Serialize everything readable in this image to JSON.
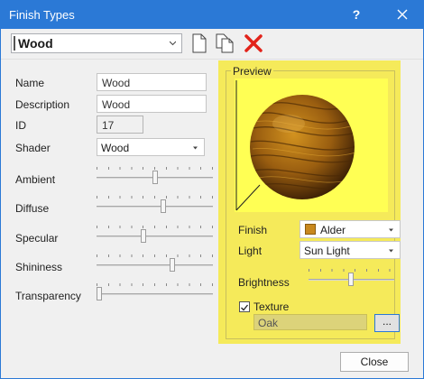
{
  "window": {
    "title": "Finish Types",
    "help_label": "?"
  },
  "toolbar": {
    "finish_selected": "Wood",
    "new_icon": "new-document-icon",
    "copy_icon": "copy-document-icon",
    "delete_icon": "delete-x-icon",
    "delete_color": "#e2231a"
  },
  "form": {
    "name_label": "Name",
    "name_value": "Wood",
    "description_label": "Description",
    "description_value": "Wood",
    "id_label": "ID",
    "id_value": "17",
    "shader_label": "Shader",
    "shader_value": "Wood",
    "sliders": [
      {
        "label": "Ambient",
        "level": 0.5
      },
      {
        "label": "Diffuse",
        "level": 0.58
      },
      {
        "label": "Specular",
        "level": 0.4
      },
      {
        "label": "Shininess",
        "level": 0.66
      },
      {
        "label": "Transparency",
        "level": 0.0
      }
    ]
  },
  "preview": {
    "group_label": "Preview",
    "finish_label": "Finish",
    "finish_value": "Alder",
    "finish_swatch_color": "#c8881e",
    "light_label": "Light",
    "light_value": "Sun Light",
    "brightness_label": "Brightness",
    "brightness_level": 0.49,
    "texture_label": "Texture",
    "texture_checked": true,
    "texture_value": "Oak",
    "browse_label": "...",
    "highlight_color": "#f5ea5a"
  },
  "footer": {
    "close_label": "Close"
  }
}
